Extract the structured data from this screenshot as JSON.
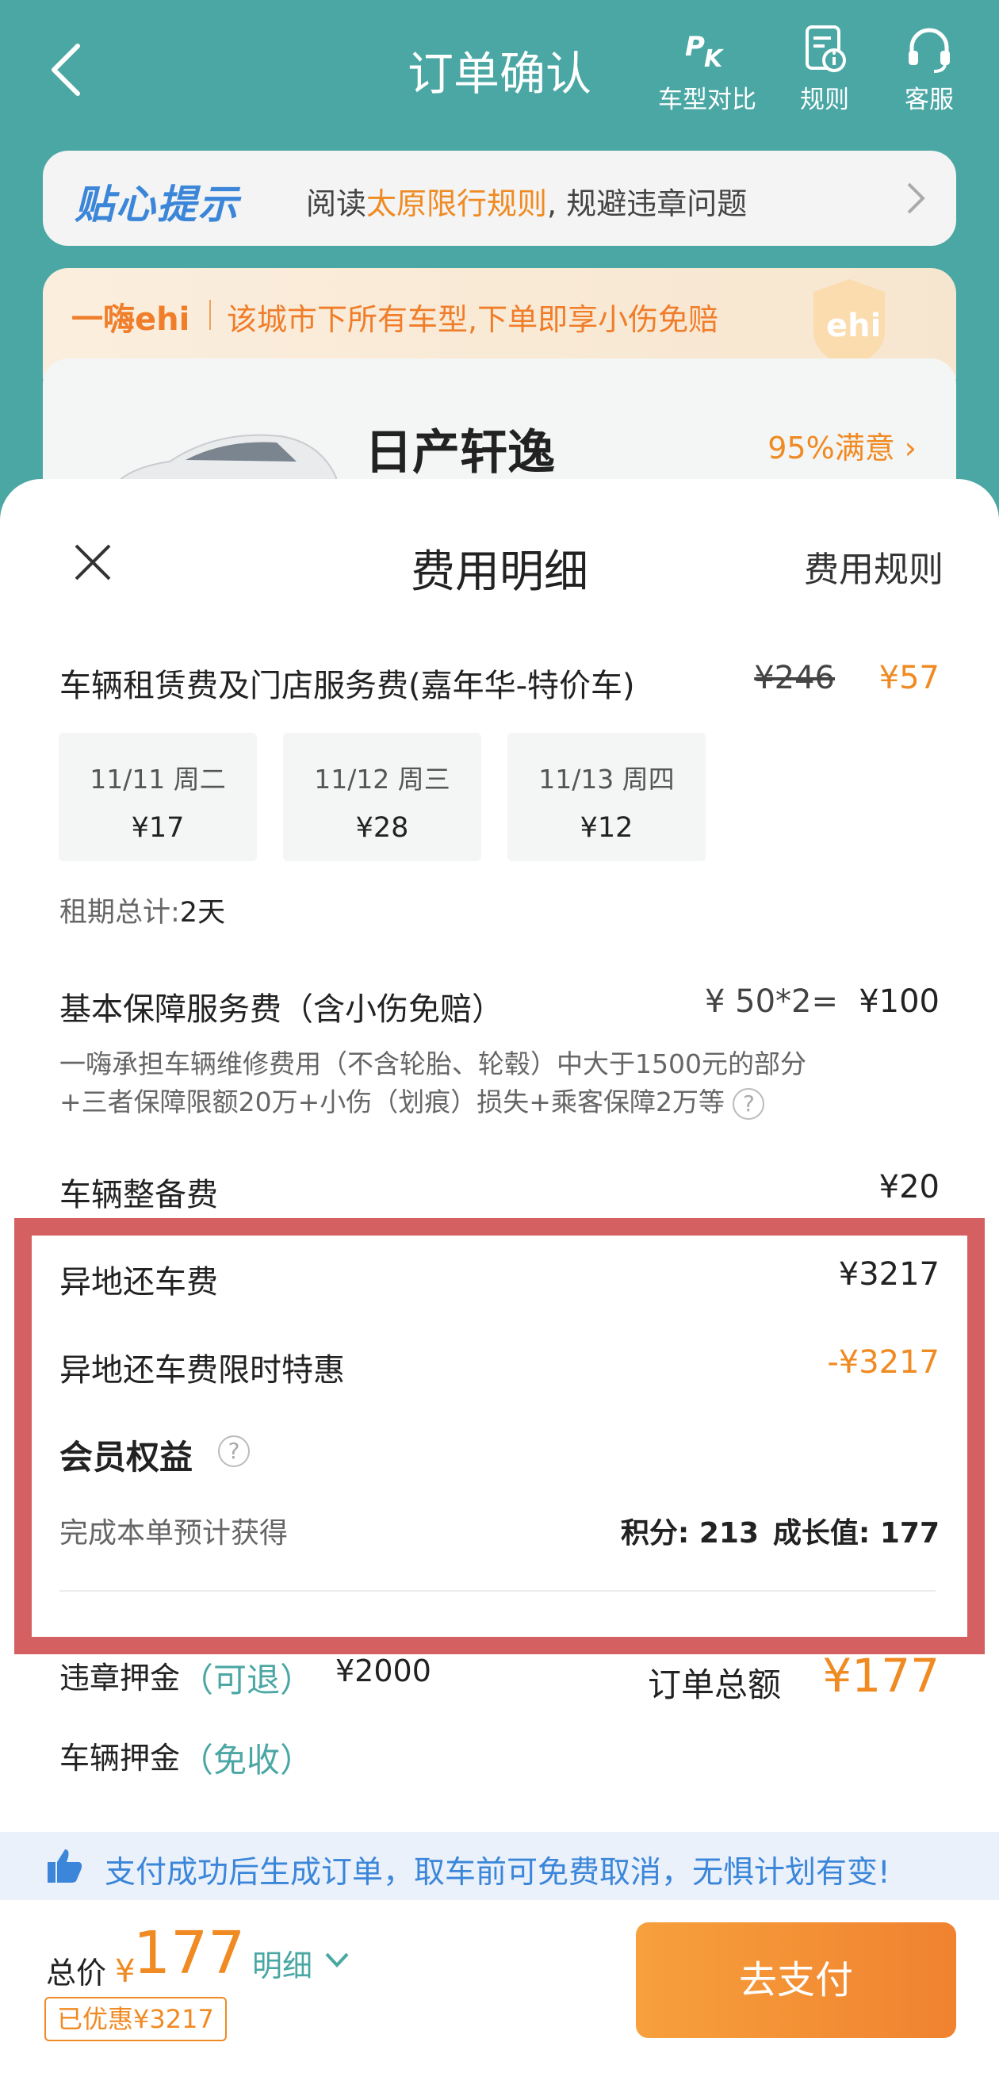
{
  "header": {
    "title": "订单确认",
    "buttons": {
      "compare": "车型对比",
      "rules": "规则",
      "service": "客服"
    },
    "colors": {
      "header_bg": "#4aa7a4",
      "accent": "#f08a22"
    }
  },
  "tip": {
    "brand": "贴心提示",
    "prefix": "阅读",
    "highlight": "太原限行规则",
    "suffix": ", 规避违章问题"
  },
  "promo": {
    "logo": "一嗨ehi",
    "text": "该城市下所有车型,下单即享小伤免赔",
    "badge": "ehi"
  },
  "car": {
    "name": "日产轩逸",
    "satisfaction": "95%满意"
  },
  "sheet": {
    "title": "费用明细",
    "rules_link": "费用规则",
    "rental": {
      "label": "车辆租赁费及门店服务费(嘉年华-特价车)",
      "original": "¥246",
      "price": "¥57",
      "days": [
        {
          "date": "11/11 周二",
          "price": "¥17"
        },
        {
          "date": "11/12 周三",
          "price": "¥28"
        },
        {
          "date": "11/13 周四",
          "price": "¥12"
        }
      ],
      "period_label": "租期总计:",
      "period_value": "2天"
    },
    "insurance": {
      "label": "基本保障服务费（含小伤免赔）",
      "formula": "¥ 50*2=",
      "price": "¥100",
      "desc_line1": "一嗨承担车辆维修费用（不含轮胎、轮毂）中大于1500元的部分",
      "desc_line2": "+三者保障限额20万+小伤（划痕）损失+乘客保障2万等"
    },
    "prep": {
      "label": "车辆整备费",
      "price": "¥20"
    },
    "oneway": {
      "label": "异地还车费",
      "price": "¥3217"
    },
    "oneway_discount": {
      "label": "异地还车费限时特惠",
      "price": "-¥3217"
    },
    "member": {
      "label": "会员权益",
      "desc": "完成本单预计获得",
      "points": "积分: 213",
      "growth": "成长值: 177"
    },
    "deposit_violation": {
      "label": "违章押金",
      "tag": "（可退）",
      "amount": "¥2000"
    },
    "deposit_vehicle": {
      "label": "车辆押金",
      "tag": "（免收）"
    },
    "order_total": {
      "label": "订单总额",
      "amount": "¥177"
    }
  },
  "notice": "支付成功后生成订单，取车前可免费取消，无惧计划有变!",
  "bottom": {
    "total_label": "总价",
    "currency": "¥",
    "total": "177",
    "detail": "明细",
    "saved": "已优惠¥3217",
    "pay": "去支付"
  }
}
